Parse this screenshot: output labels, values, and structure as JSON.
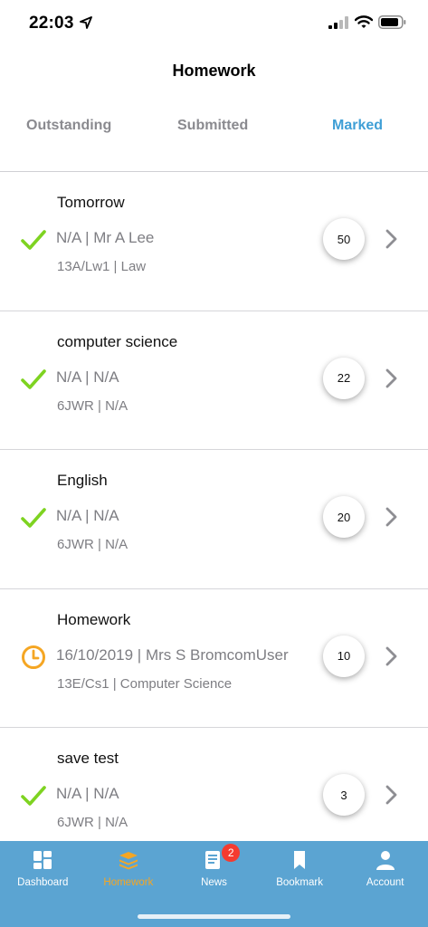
{
  "status_bar": {
    "time": "22:03"
  },
  "nav": {
    "title": "Homework"
  },
  "tabs": [
    {
      "label": "Outstanding",
      "active": false
    },
    {
      "label": "Submitted",
      "active": false
    },
    {
      "label": "Marked",
      "active": true
    }
  ],
  "colors": {
    "accent": "#3f9fd6",
    "tabbar_bg": "#5ba4d2",
    "active_tab": "#f5a623",
    "check_green": "#7ed321",
    "clock_orange": "#f5a623",
    "badge_red": "#f43b30"
  },
  "homework_items": [
    {
      "title": "Tomorrow",
      "line1": "N/A | Mr A Lee",
      "line2": "13A/Lw1 | Law",
      "score": "50",
      "status_icon": "check-icon"
    },
    {
      "title": "computer science",
      "line1": "N/A | N/A",
      "line2": "6JWR | N/A",
      "score": "22",
      "status_icon": "check-icon"
    },
    {
      "title": "English",
      "line1": "N/A | N/A",
      "line2": "6JWR | N/A",
      "score": "20",
      "status_icon": "check-icon"
    },
    {
      "title": "Homework",
      "line1": "16/10/2019 | Mrs S BromcomUser",
      "line2": "13E/Cs1 | Computer Science",
      "score": "10",
      "status_icon": "clock-icon"
    },
    {
      "title": "save test",
      "line1": "N/A | N/A",
      "line2": "6JWR | N/A",
      "score": "3",
      "status_icon": "check-icon"
    }
  ],
  "tab_bar": [
    {
      "label": "Dashboard",
      "icon": "dashboard-icon",
      "active": false
    },
    {
      "label": "Homework",
      "icon": "homework-stack-icon",
      "active": true
    },
    {
      "label": "News",
      "icon": "news-icon",
      "active": false,
      "badge": "2"
    },
    {
      "label": "Bookmark",
      "icon": "bookmark-icon",
      "active": false
    },
    {
      "label": "Account",
      "icon": "account-icon",
      "active": false
    }
  ]
}
